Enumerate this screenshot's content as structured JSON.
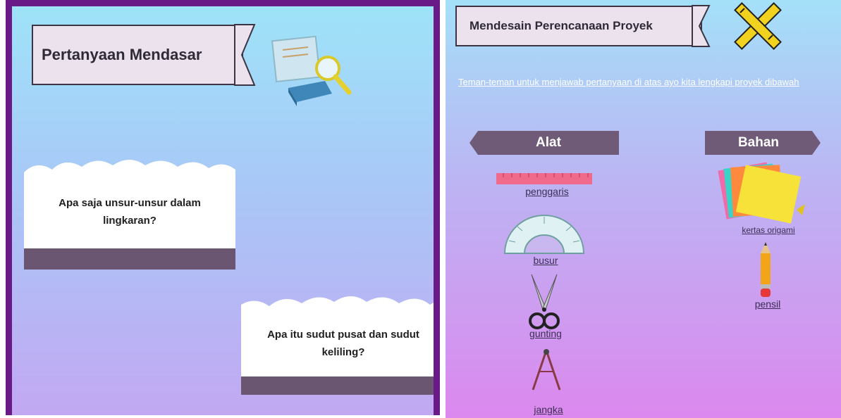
{
  "left_panel": {
    "title": "Pertanyaan Mendasar",
    "icon": "magnifier-book-icon",
    "questions": [
      "Apa saja unsur-unsur dalam lingkaran?",
      "Apa itu sudut pusat dan sudut keliling?"
    ]
  },
  "right_panel": {
    "title": "Mendesain Perencanaan Proyek",
    "icon": "ruler-pencil-icon",
    "instruction": "Teman-teman untuk menjawab pertanyaan di atas ayo kita lengkapi proyek dibawah",
    "tools": {
      "header": "Alat",
      "items": [
        "penggaris",
        "busur",
        "gunting",
        "jangka"
      ]
    },
    "materials": {
      "header": "Bahan",
      "items": [
        "kertas origami",
        "pensil"
      ]
    }
  },
  "colors": {
    "panel_border": "#6a1a86",
    "banner_fill": "#ebe2ee",
    "tag_fill": "#6f5b78",
    "card_bar": "#6b5672"
  }
}
